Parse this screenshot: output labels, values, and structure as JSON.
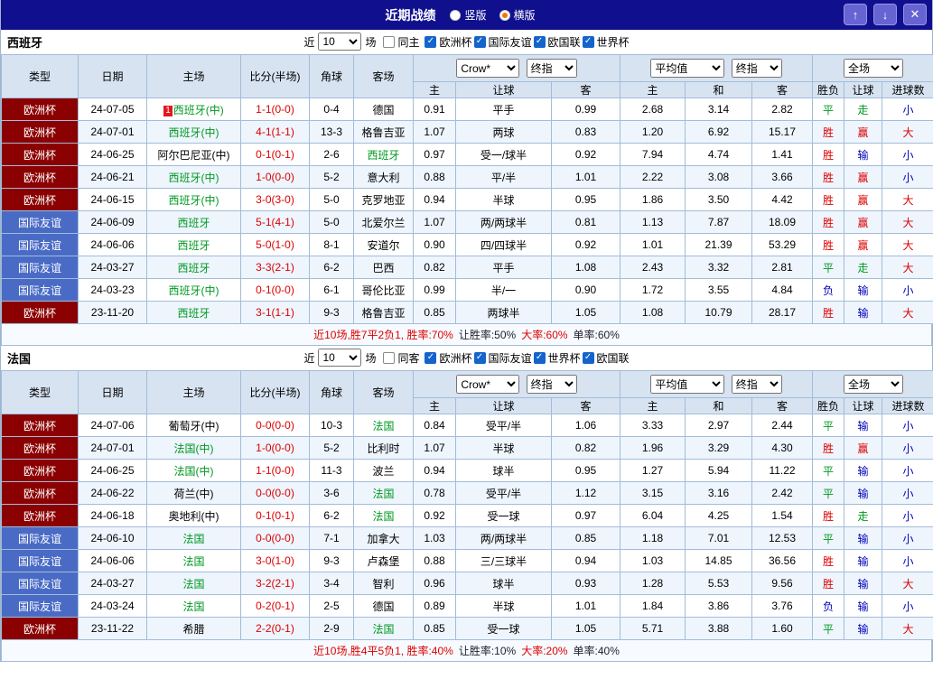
{
  "icons": {
    "check": "✓",
    "up_arrow": "↑",
    "down_arrow": "↓",
    "close": "✕"
  },
  "colors": {
    "accent_navy": "#10108F",
    "euro_cup_bg": "#8B0101",
    "friendly_bg": "#4A6BC5",
    "win_red": "#DD0000",
    "draw_green": "#009922",
    "lose_blue": "#0000BB"
  },
  "title_bar": {
    "title": "近期战绩",
    "view_options": [
      {
        "label": "竖版",
        "selected": false
      },
      {
        "label": "横版",
        "selected": true
      }
    ]
  },
  "table_headers": {
    "type": "类型",
    "date": "日期",
    "home": "主场",
    "score": "比分(半场)",
    "corner": "角球",
    "away": "客场",
    "odds_dropdown_1": "Crow*",
    "odds_dropdown_2": "终指",
    "avg_dropdown_1": "平均值",
    "avg_dropdown_2": "终指",
    "result_dropdown": "全场",
    "sub": [
      "主",
      "让球",
      "客",
      "主",
      "和",
      "客",
      "胜负",
      "让球",
      "进球数"
    ]
  },
  "sections": [
    {
      "team": "西班牙",
      "filter": {
        "near": "近",
        "count": "10",
        "matches": "场",
        "same_venue": "同主",
        "competitions": [
          "欧洲杯",
          "国际友谊",
          "欧国联",
          "世界杯"
        ]
      },
      "rows": [
        {
          "type": "欧洲杯",
          "date": "24-07-05",
          "badge": "1",
          "home": "西班牙(中)",
          "home_green": true,
          "score": "1-1(0-0)",
          "corner": "0-4",
          "away": "德国",
          "o_home": "0.91",
          "handicap": "平手",
          "o_away": "0.99",
          "avg_home": "2.68",
          "avg_draw": "3.14",
          "avg_away": "2.82",
          "res": "平",
          "res_handicap": "走",
          "res_goals": "小"
        },
        {
          "type": "欧洲杯",
          "date": "24-07-01",
          "home": "西班牙(中)",
          "home_green": true,
          "score": "4-1(1-1)",
          "corner": "13-3",
          "away": "格鲁吉亚",
          "o_home": "1.07",
          "handicap": "两球",
          "o_away": "0.83",
          "avg_home": "1.20",
          "avg_draw": "6.92",
          "avg_away": "15.17",
          "res": "胜",
          "res_handicap": "赢",
          "res_goals": "大"
        },
        {
          "type": "欧洲杯",
          "date": "24-06-25",
          "home": "阿尔巴尼亚(中)",
          "score": "0-1(0-1)",
          "corner": "2-6",
          "away": "西班牙",
          "away_green": true,
          "o_home": "0.97",
          "handicap": "受一/球半",
          "o_away": "0.92",
          "avg_home": "7.94",
          "avg_draw": "4.74",
          "avg_away": "1.41",
          "res": "胜",
          "res_handicap": "输",
          "res_goals": "小"
        },
        {
          "type": "欧洲杯",
          "date": "24-06-21",
          "home": "西班牙(中)",
          "home_green": true,
          "score": "1-0(0-0)",
          "corner": "5-2",
          "away": "意大利",
          "o_home": "0.88",
          "handicap": "平/半",
          "o_away": "1.01",
          "avg_home": "2.22",
          "avg_draw": "3.08",
          "avg_away": "3.66",
          "res": "胜",
          "res_handicap": "赢",
          "res_goals": "小"
        },
        {
          "type": "欧洲杯",
          "date": "24-06-15",
          "home": "西班牙(中)",
          "home_green": true,
          "score": "3-0(3-0)",
          "corner": "5-0",
          "away": "克罗地亚",
          "o_home": "0.94",
          "handicap": "半球",
          "o_away": "0.95",
          "avg_home": "1.86",
          "avg_draw": "3.50",
          "avg_away": "4.42",
          "res": "胜",
          "res_handicap": "赢",
          "res_goals": "大"
        },
        {
          "type": "国际友谊",
          "date": "24-06-09",
          "home": "西班牙",
          "home_green": true,
          "score": "5-1(4-1)",
          "corner": "5-0",
          "away": "北爱尔兰",
          "o_home": "1.07",
          "handicap": "两/两球半",
          "o_away": "0.81",
          "avg_home": "1.13",
          "avg_draw": "7.87",
          "avg_away": "18.09",
          "res": "胜",
          "res_handicap": "赢",
          "res_goals": "大"
        },
        {
          "type": "国际友谊",
          "date": "24-06-06",
          "home": "西班牙",
          "home_green": true,
          "score": "5-0(1-0)",
          "corner": "8-1",
          "away": "安道尔",
          "o_home": "0.90",
          "handicap": "四/四球半",
          "o_away": "0.92",
          "avg_home": "1.01",
          "avg_draw": "21.39",
          "avg_away": "53.29",
          "res": "胜",
          "res_handicap": "赢",
          "res_goals": "大"
        },
        {
          "type": "国际友谊",
          "date": "24-03-27",
          "home": "西班牙",
          "home_green": true,
          "score": "3-3(2-1)",
          "corner": "6-2",
          "away": "巴西",
          "o_home": "0.82",
          "handicap": "平手",
          "o_away": "1.08",
          "avg_home": "2.43",
          "avg_draw": "3.32",
          "avg_away": "2.81",
          "res": "平",
          "res_handicap": "走",
          "res_goals": "大"
        },
        {
          "type": "国际友谊",
          "date": "24-03-23",
          "home": "西班牙(中)",
          "home_green": true,
          "score": "0-1(0-0)",
          "corner": "6-1",
          "away": "哥伦比亚",
          "o_home": "0.99",
          "handicap": "半/一",
          "o_away": "0.90",
          "avg_home": "1.72",
          "avg_draw": "3.55",
          "avg_away": "4.84",
          "res": "负",
          "res_handicap": "输",
          "res_goals": "小"
        },
        {
          "type": "欧洲杯",
          "date": "23-11-20",
          "home": "西班牙",
          "home_green": true,
          "score": "3-1(1-1)",
          "corner": "9-3",
          "away": "格鲁吉亚",
          "o_home": "0.85",
          "handicap": "两球半",
          "o_away": "1.05",
          "avg_home": "1.08",
          "avg_draw": "10.79",
          "avg_away": "28.17",
          "res": "胜",
          "res_handicap": "输",
          "res_goals": "大"
        }
      ],
      "summary": [
        {
          "text": "近10场,胜7平2负1, 胜率:70%",
          "color": "red"
        },
        {
          "text": "让胜率:50%",
          "color": "dark"
        },
        {
          "text": "大率:60%",
          "color": "red"
        },
        {
          "text": "单率:60%",
          "color": "dark"
        }
      ]
    },
    {
      "team": "法国",
      "filter": {
        "near": "近",
        "count": "10",
        "matches": "场",
        "same_venue": "同客",
        "competitions": [
          "欧洲杯",
          "国际友谊",
          "世界杯",
          "欧国联"
        ]
      },
      "rows": [
        {
          "type": "欧洲杯",
          "date": "24-07-06",
          "home": "葡萄牙(中)",
          "score": "0-0(0-0)",
          "corner": "10-3",
          "away": "法国",
          "away_green": true,
          "o_home": "0.84",
          "handicap": "受平/半",
          "o_away": "1.06",
          "avg_home": "3.33",
          "avg_draw": "2.97",
          "avg_away": "2.44",
          "res": "平",
          "res_handicap": "输",
          "res_goals": "小"
        },
        {
          "type": "欧洲杯",
          "date": "24-07-01",
          "home": "法国(中)",
          "home_green": true,
          "score": "1-0(0-0)",
          "corner": "5-2",
          "away": "比利时",
          "o_home": "1.07",
          "handicap": "半球",
          "o_away": "0.82",
          "avg_home": "1.96",
          "avg_draw": "3.29",
          "avg_away": "4.30",
          "res": "胜",
          "res_handicap": "赢",
          "res_goals": "小"
        },
        {
          "type": "欧洲杯",
          "date": "24-06-25",
          "home": "法国(中)",
          "home_green": true,
          "score": "1-1(0-0)",
          "corner": "11-3",
          "away": "波兰",
          "o_home": "0.94",
          "handicap": "球半",
          "o_away": "0.95",
          "avg_home": "1.27",
          "avg_draw": "5.94",
          "avg_away": "11.22",
          "res": "平",
          "res_handicap": "输",
          "res_goals": "小"
        },
        {
          "type": "欧洲杯",
          "date": "24-06-22",
          "home": "荷兰(中)",
          "score": "0-0(0-0)",
          "corner": "3-6",
          "away": "法国",
          "away_green": true,
          "o_home": "0.78",
          "handicap": "受平/半",
          "o_away": "1.12",
          "avg_home": "3.15",
          "avg_draw": "3.16",
          "avg_away": "2.42",
          "res": "平",
          "res_handicap": "输",
          "res_goals": "小"
        },
        {
          "type": "欧洲杯",
          "date": "24-06-18",
          "home": "奥地利(中)",
          "score": "0-1(0-1)",
          "corner": "6-2",
          "away": "法国",
          "away_green": true,
          "o_home": "0.92",
          "handicap": "受一球",
          "o_away": "0.97",
          "avg_home": "6.04",
          "avg_draw": "4.25",
          "avg_away": "1.54",
          "res": "胜",
          "res_handicap": "走",
          "res_goals": "小"
        },
        {
          "type": "国际友谊",
          "date": "24-06-10",
          "home": "法国",
          "home_green": true,
          "score": "0-0(0-0)",
          "corner": "7-1",
          "away": "加拿大",
          "o_home": "1.03",
          "handicap": "两/两球半",
          "o_away": "0.85",
          "avg_home": "1.18",
          "avg_draw": "7.01",
          "avg_away": "12.53",
          "res": "平",
          "res_handicap": "输",
          "res_goals": "小"
        },
        {
          "type": "国际友谊",
          "date": "24-06-06",
          "home": "法国",
          "home_green": true,
          "score": "3-0(1-0)",
          "corner": "9-3",
          "away": "卢森堡",
          "o_home": "0.88",
          "handicap": "三/三球半",
          "o_away": "0.94",
          "avg_home": "1.03",
          "avg_draw": "14.85",
          "avg_away": "36.56",
          "res": "胜",
          "res_handicap": "输",
          "res_goals": "小"
        },
        {
          "type": "国际友谊",
          "date": "24-03-27",
          "home": "法国",
          "home_green": true,
          "score": "3-2(2-1)",
          "corner": "3-4",
          "away": "智利",
          "o_home": "0.96",
          "handicap": "球半",
          "o_away": "0.93",
          "avg_home": "1.28",
          "avg_draw": "5.53",
          "avg_away": "9.56",
          "res": "胜",
          "res_handicap": "输",
          "res_goals": "大"
        },
        {
          "type": "国际友谊",
          "date": "24-03-24",
          "home": "法国",
          "home_green": true,
          "score": "0-2(0-1)",
          "corner": "2-5",
          "away": "德国",
          "o_home": "0.89",
          "handicap": "半球",
          "o_away": "1.01",
          "avg_home": "1.84",
          "avg_draw": "3.86",
          "avg_away": "3.76",
          "res": "负",
          "res_handicap": "输",
          "res_goals": "小"
        },
        {
          "type": "欧洲杯",
          "date": "23-11-22",
          "home": "希腊",
          "score": "2-2(0-1)",
          "corner": "2-9",
          "away": "法国",
          "away_green": true,
          "o_home": "0.85",
          "handicap": "受一球",
          "o_away": "1.05",
          "avg_home": "5.71",
          "avg_draw": "3.88",
          "avg_away": "1.60",
          "res": "平",
          "res_handicap": "输",
          "res_goals": "大"
        }
      ],
      "summary": [
        {
          "text": "近10场,胜4平5负1, 胜率:40%",
          "color": "red"
        },
        {
          "text": "让胜率:10%",
          "color": "dark"
        },
        {
          "text": "大率:20%",
          "color": "red"
        },
        {
          "text": "单率:40%",
          "color": "dark"
        }
      ]
    }
  ]
}
